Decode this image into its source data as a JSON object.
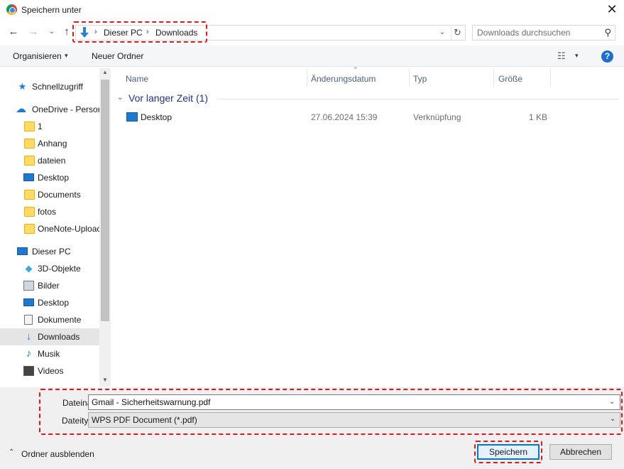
{
  "window": {
    "title": "Speichern unter",
    "close_glyph": "✕"
  },
  "nav": {
    "back": "←",
    "forward": "→",
    "recent": "⌄",
    "up": "↑",
    "breadcrumbs": [
      "Dieser PC",
      "Downloads"
    ],
    "crumb_separator": "›",
    "dropdown_glyph": "⌄",
    "refresh_glyph": "↻",
    "search_placeholder": "Downloads durchsuchen",
    "search_glyph": "⚲"
  },
  "toolbar": {
    "organize": "Organisieren",
    "organize_caret": "▾",
    "new_folder": "Neuer Ordner",
    "view_glyph": "☷",
    "view_caret": "▾",
    "help": "?"
  },
  "sidebar": {
    "items": [
      {
        "label": "Schnellzugriff",
        "icon": "star-icon"
      },
      {
        "label": "OneDrive - Persor",
        "icon": "cloud-icon"
      },
      {
        "label": "1",
        "icon": "folder-icon"
      },
      {
        "label": "Anhang",
        "icon": "folder-icon"
      },
      {
        "label": "dateien",
        "icon": "folder-icon"
      },
      {
        "label": "Desktop",
        "icon": "desktop-icon"
      },
      {
        "label": "Documents",
        "icon": "folder-icon"
      },
      {
        "label": "fotos",
        "icon": "folder-icon"
      },
      {
        "label": "OneNote-Uploac",
        "icon": "folder-icon"
      },
      {
        "label": "Dieser PC",
        "icon": "pc-icon"
      },
      {
        "label": "3D-Objekte",
        "icon": "cube-icon"
      },
      {
        "label": "Bilder",
        "icon": "pictures-icon"
      },
      {
        "label": "Desktop",
        "icon": "desktop-icon"
      },
      {
        "label": "Dokumente",
        "icon": "documents-icon"
      },
      {
        "label": "Downloads",
        "icon": "download-icon",
        "selected": true
      },
      {
        "label": "Musik",
        "icon": "music-icon"
      },
      {
        "label": "Videos",
        "icon": "video-icon"
      }
    ],
    "scroll_up": "▲",
    "scroll_down": "▼"
  },
  "filelist": {
    "columns": [
      "Name",
      "Änderungsdatum",
      "Typ",
      "Größe"
    ],
    "sort_glyph": "⌃",
    "group": {
      "label": "Vor langer Zeit (1)",
      "caret": "⌄"
    },
    "rows": [
      {
        "name": "Desktop",
        "date": "27.06.2024 15:39",
        "type": "Verknüpfung",
        "size": "1 KB"
      }
    ]
  },
  "form": {
    "filename_label": "Dateiname:",
    "filename_value": "Gmail - Sicherheitswarnung.pdf",
    "filetype_label": "Dateityp:",
    "filetype_value": "WPS PDF Document (*.pdf)",
    "caret": "⌄",
    "hide_folders": "Ordner ausblenden",
    "hide_caret": "⌃",
    "save": "Speichern",
    "cancel": "Abbrechen"
  },
  "colors": {
    "accent": "#0078d7",
    "highlight": "#e4181b",
    "help": "#1a6fd0",
    "group_header": "#1e3287"
  }
}
